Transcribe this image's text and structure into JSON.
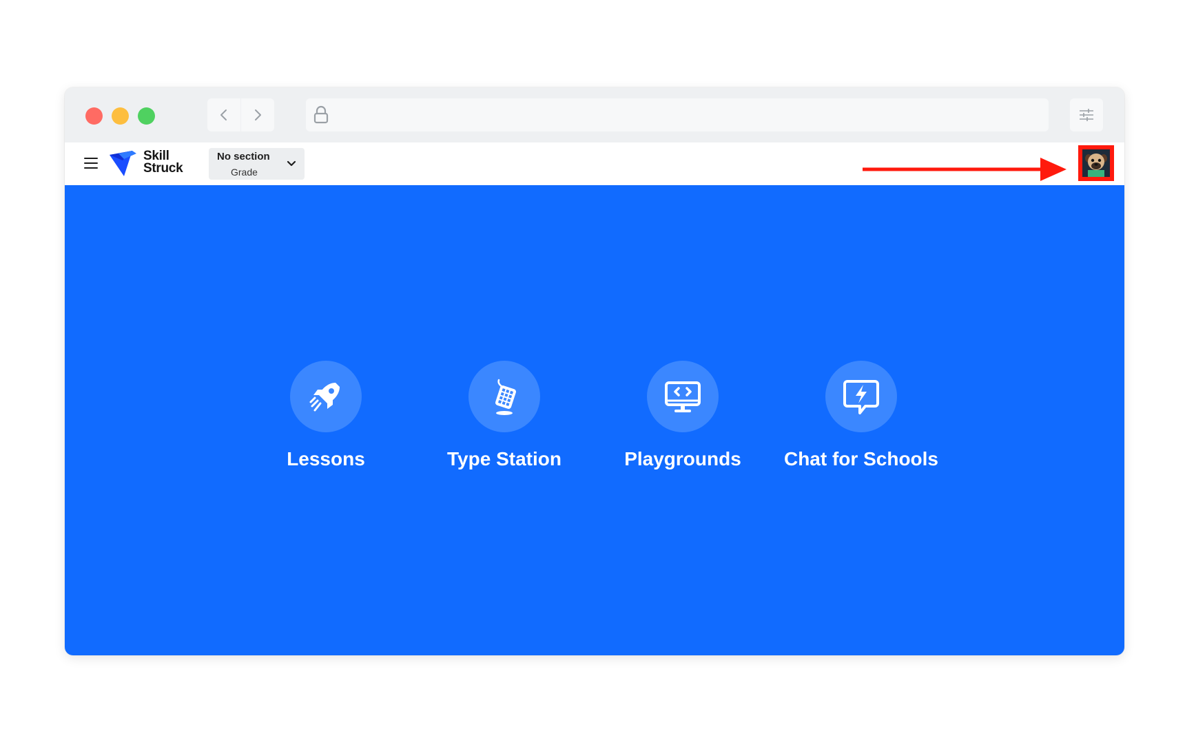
{
  "browser": {
    "traffic_lights": [
      "close",
      "minimize",
      "maximize"
    ],
    "nav": {
      "back_icon": "chevron-left-icon",
      "forward_icon": "chevron-right-icon"
    },
    "address_bar": {
      "icon": "lock-icon",
      "value": ""
    },
    "settings_icon": "sliders-icon"
  },
  "app_header": {
    "menu_icon": "hamburger-icon",
    "logo": {
      "line1": "Skill",
      "line2": "Struck"
    },
    "section_dropdown": {
      "selected": "No section",
      "sublabel": "Grade",
      "icon": "chevron-down-icon"
    },
    "avatar_icon": "pug-avatar-icon"
  },
  "annotation": {
    "arrow_color": "#ff1a0d",
    "highlight_color": "#ff1a0d"
  },
  "main": {
    "background": "#116bff",
    "tiles": [
      {
        "label": "Lessons",
        "icon": "rocket-icon"
      },
      {
        "label": "Type Station",
        "icon": "keypad-icon"
      },
      {
        "label": "Playgrounds",
        "icon": "code-monitor-icon"
      },
      {
        "label": "Chat for Schools",
        "icon": "chat-bolt-icon"
      }
    ]
  }
}
